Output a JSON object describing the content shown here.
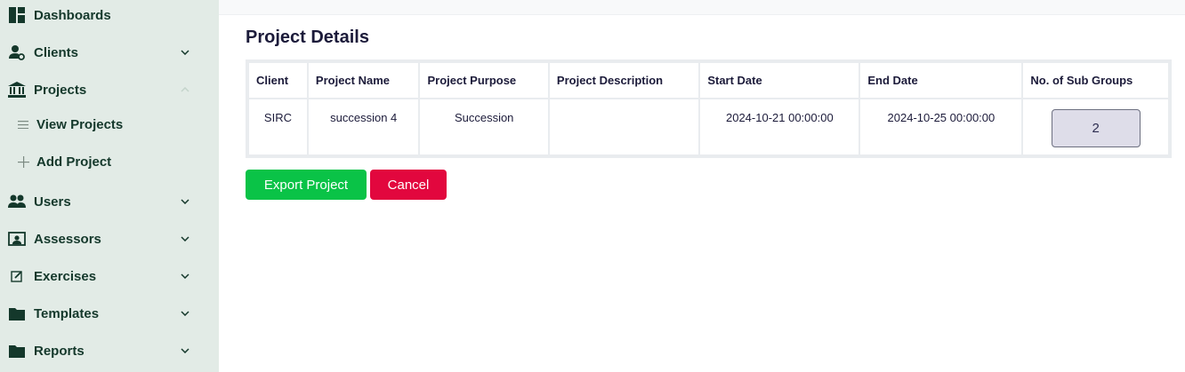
{
  "sidebar": {
    "items": [
      {
        "label": "Dashboards"
      },
      {
        "label": "Clients"
      },
      {
        "label": "Projects"
      },
      {
        "label": "View Projects"
      },
      {
        "label": "Add Project"
      },
      {
        "label": "Users"
      },
      {
        "label": "Assessors"
      },
      {
        "label": "Exercises"
      },
      {
        "label": "Templates"
      },
      {
        "label": "Reports"
      }
    ]
  },
  "main": {
    "title": "Project Details",
    "table": {
      "headers": [
        "Client",
        "Project Name",
        "Project Purpose",
        "Project Description",
        "Start Date",
        "End Date",
        "No. of Sub Groups"
      ],
      "rows": [
        [
          "SIRC",
          "succession 4",
          "Succession",
          "",
          "2024-10-21 00:00:00",
          "2024-10-25 00:00:00",
          "2"
        ]
      ]
    },
    "buttons": {
      "export_label": "Export Project",
      "cancel_label": "Cancel"
    }
  },
  "colors": {
    "sidebar_bg": "#e2ebe6",
    "sidebar_text": "#14382b",
    "export": "#0ac347",
    "cancel": "#e2073e",
    "subgroup_box": "#dedde9"
  }
}
